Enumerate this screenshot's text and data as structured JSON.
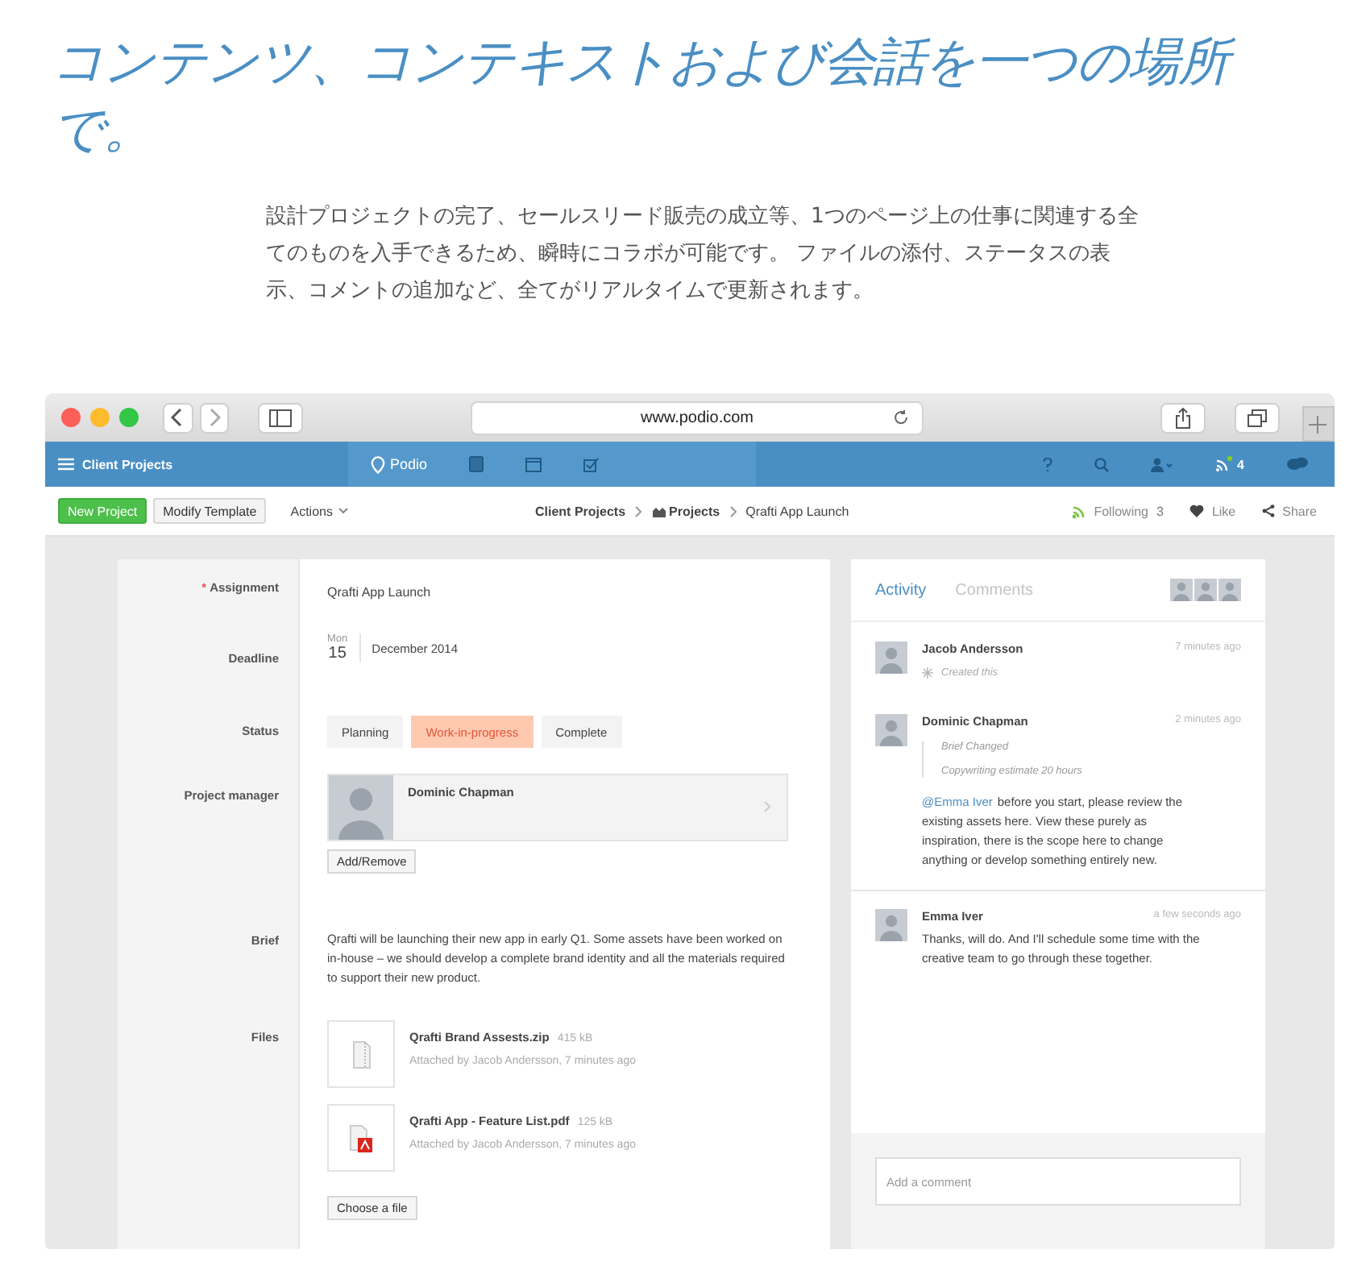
{
  "heading": "コンテンツ、コンテキストおよび会話を一つの場所で。",
  "intro": "設計プロジェクトの完了、セールスリード販売の成立等、1つのページ上の仕事に関連する全てのものを入手できるため、瞬時にコラボが可能です。 ファイルの添付、ステータスの表示、コメントの追加など、全てがリアルタイムで更新されます。",
  "browser": {
    "url": "www.podio.com"
  },
  "app_bar": {
    "workspace": "Client Projects",
    "logo": "Podio",
    "notifications": "4"
  },
  "toolbar": {
    "buttons": [
      {
        "label": "New Project",
        "kind": "primary"
      },
      {
        "label": "Modify Template",
        "kind": "plain"
      }
    ],
    "actions": "Actions",
    "breadcrumb": [
      {
        "label": "Client Projects",
        "kind": "workspace"
      },
      {
        "label": "Projects",
        "kind": "app"
      },
      {
        "label": "Qrafti App Launch",
        "kind": "item"
      }
    ],
    "following": {
      "label": "Following",
      "count": "3"
    },
    "like": "Like",
    "share": "Share"
  },
  "required_mark": "*",
  "fields": [
    {
      "kind": "text",
      "label": "Assignment",
      "required": true,
      "value": "Qrafti App Launch"
    },
    {
      "kind": "date",
      "label": "Deadline",
      "required": false,
      "weekday": "Mon",
      "day": "15",
      "month_year": "December 2014"
    },
    {
      "kind": "status",
      "label": "Status",
      "required": false,
      "options": [
        {
          "label": "Planning",
          "selected": false
        },
        {
          "label": "Work-in-progress",
          "selected": true
        },
        {
          "label": "Complete",
          "selected": false
        }
      ]
    },
    {
      "kind": "person",
      "label": "Project manager",
      "required": false,
      "name": "Dominic Chapman",
      "button": "Add/Remove"
    },
    {
      "kind": "brief",
      "label": "Brief",
      "required": false,
      "value": "Qrafti will be launching their new app in early Q1. Some assets have been worked on in-house – we should develop a complete brand identity and all the materials required to support their new product."
    },
    {
      "kind": "files",
      "label": "Files",
      "required": false,
      "button": "Choose a file",
      "files": [
        {
          "kind": "zip",
          "name": "Qrafti Brand Assests.zip",
          "size": "415 kB",
          "meta": "Attached by Jacob Andersson, 7 minutes ago"
        },
        {
          "kind": "pdf",
          "name": "Qrafti App - Feature List.pdf",
          "size": "125 kB",
          "meta": "Attached by Jacob Andersson, 7 minutes ago"
        }
      ]
    }
  ],
  "activity": {
    "tabs": [
      {
        "label": "Activity",
        "selected": true
      },
      {
        "label": "Comments",
        "selected": false
      }
    ],
    "entries": [
      {
        "author": "Jacob Andersson",
        "time": "7 minutes ago",
        "note": "Created this"
      },
      {
        "author": "Dominic Chapman",
        "time": "2 minutes ago",
        "changes": [
          "Brief Changed",
          "Copywriting estimate 20 hours"
        ],
        "mention": "@Emma Iver",
        "message": "before you start, please review the existing assets here. View these purely as inspiration, there is the scope here to change anything or develop something entirely new."
      },
      {
        "author": "Emma Iver",
        "time": "a few seconds ago",
        "message": "Thanks, will do. And I'll schedule some time with the creative team to go through these together."
      }
    ],
    "comment_placeholder": "Add a comment"
  }
}
